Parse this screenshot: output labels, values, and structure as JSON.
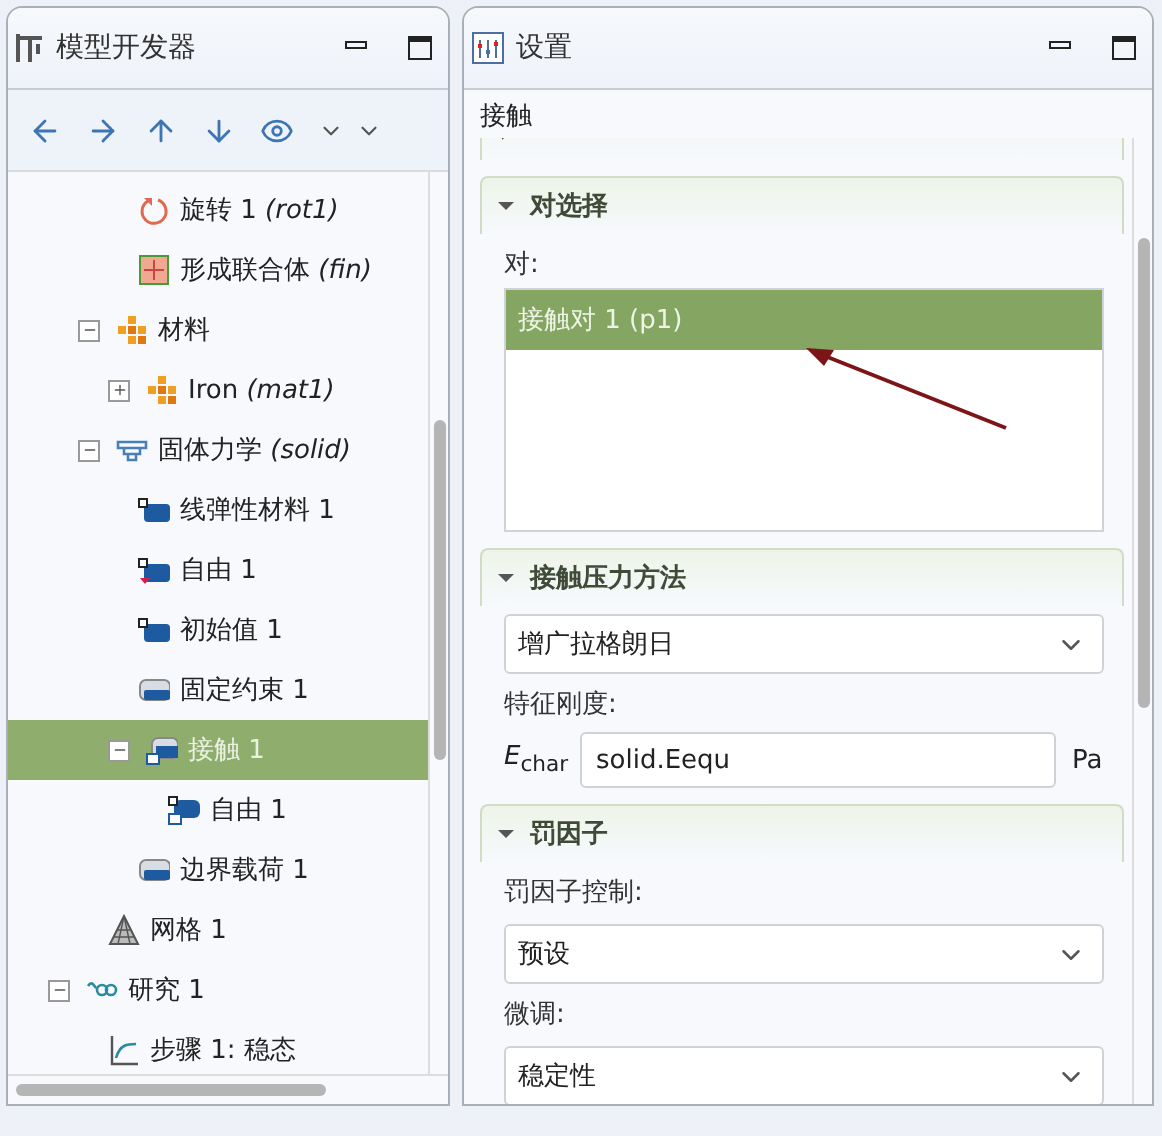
{
  "model_builder": {
    "title": "模型开发器",
    "tree": [
      {
        "children": [
          {
            "children": [
              {
                "label": "旋转 1 *(rot1)*",
                "kind": "rotate",
                "selected": false
              },
              {
                "label": "形成联合体 *(fin)*",
                "kind": "union",
                "selected": false
              }
            ]
          },
          {
            "label": "材料",
            "kind": "materials",
            "expanded": true,
            "selected": false,
            "children": [
              {
                "label": "Iron *(mat1)*",
                "kind": "materials",
                "expanded": false,
                "selected": false
              }
            ]
          },
          {
            "label": "固体力学 *(solid)*",
            "kind": "physics",
            "expanded": true,
            "selected": false,
            "children": [
              {
                "label": "线弹性材料 1",
                "kind": "domain",
                "selected": false
              },
              {
                "label": "自由 1",
                "kind": "free",
                "selected": false
              },
              {
                "label": "初始值 1",
                "kind": "domain",
                "selected": false
              },
              {
                "label": "固定约束 1",
                "kind": "boundary",
                "selected": false
              },
              {
                "label": "接触 1",
                "kind": "contact",
                "expanded": true,
                "selected": true,
                "children": [
                  {
                    "label": "自由 1",
                    "kind": "contact-free",
                    "selected": false
                  }
                ]
              },
              {
                "label": "边界载荷 1",
                "kind": "boundary",
                "selected": false
              }
            ]
          },
          {
            "label": "网格 1",
            "kind": "mesh",
            "selected": false
          }
        ]
      },
      {
        "label": "研究 1",
        "kind": "study",
        "expanded": true,
        "selected": false,
        "children": [
          {
            "label": "步骤 1: 稳态",
            "kind": "step",
            "selected": false
          }
        ]
      }
    ]
  },
  "settings": {
    "title": "设置",
    "node_title": "接触",
    "sections": [
      {
        "expanded": false
      },
      {
        "title": "对选择",
        "expanded": true,
        "fields": [
          {
            "kind": "label",
            "text": "对:"
          },
          {
            "kind": "list",
            "items": [
              {
                "label": "接触对 1 (p1)",
                "selected": true
              }
            ]
          }
        ]
      },
      {
        "title": "接触压力方法",
        "expanded": true,
        "fields": [
          {
            "kind": "select",
            "value": "增广拉格朗日"
          },
          {
            "kind": "label",
            "text": "特征刚度:"
          },
          {
            "kind": "input",
            "symbol": "*E*$_{char}$",
            "value": "solid.Eequ",
            "unit": "Pa"
          }
        ]
      },
      {
        "title": "罚因子",
        "expanded": true,
        "fields": [
          {
            "kind": "label",
            "text": "罚因子控制:"
          },
          {
            "kind": "select",
            "value": "预设"
          },
          {
            "kind": "label",
            "text": "微调:"
          },
          {
            "kind": "select",
            "value": "稳定性"
          }
        ]
      }
    ]
  }
}
